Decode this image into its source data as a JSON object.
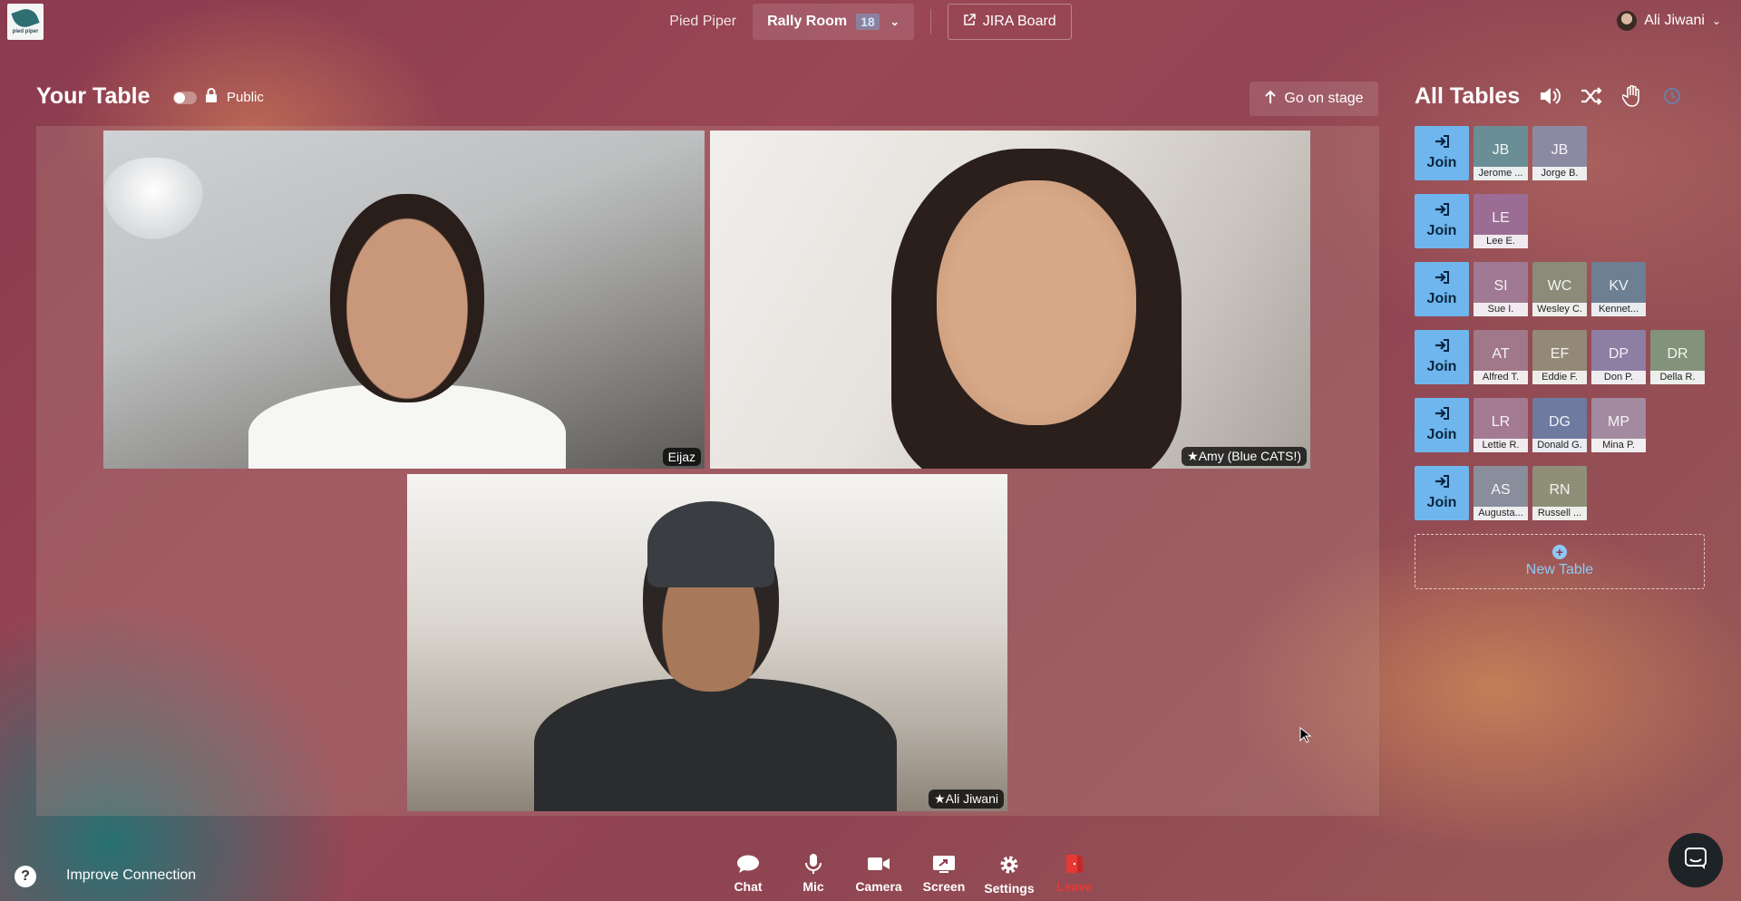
{
  "header": {
    "org_name": "Pied Piper",
    "room_name": "Rally Room",
    "room_count": "18",
    "jira_label": "JIRA Board",
    "user_name": "Ali Jiwani"
  },
  "logo": {
    "text": "pied piper"
  },
  "your_table": {
    "title": "Your Table",
    "visibility": "Public",
    "go_on_stage": "Go on stage",
    "videos": [
      {
        "name": "Eijaz",
        "starred": false
      },
      {
        "name": "Amy (Blue CATS!)",
        "starred": true
      },
      {
        "name": "Ali Jiwani",
        "starred": true
      }
    ]
  },
  "all_tables": {
    "title": "All Tables",
    "join_label": "Join",
    "new_table_label": "New Table",
    "tables": [
      {
        "seats": [
          {
            "initials": "JB",
            "name": "Jerome ...",
            "color": "#6a8e95"
          },
          {
            "initials": "JB",
            "name": "Jorge B.",
            "color": "#8c8aa3"
          }
        ]
      },
      {
        "seats": [
          {
            "initials": "LE",
            "name": "Lee E.",
            "color": "#9b6d94"
          }
        ]
      },
      {
        "seats": [
          {
            "initials": "SI",
            "name": "Sue I.",
            "color": "#a07a94"
          },
          {
            "initials": "WC",
            "name": "Wesley C.",
            "color": "#8b8b79"
          },
          {
            "initials": "KV",
            "name": "Kennet...",
            "color": "#6d7f92"
          }
        ]
      },
      {
        "seats": [
          {
            "initials": "AT",
            "name": "Alfred T.",
            "color": "#a07889"
          },
          {
            "initials": "EF",
            "name": "Eddie F.",
            "color": "#948876"
          },
          {
            "initials": "DP",
            "name": "Don P.",
            "color": "#8d7ea4"
          },
          {
            "initials": "DR",
            "name": "Della R.",
            "color": "#83927a"
          }
        ]
      },
      {
        "seats": [
          {
            "initials": "LR",
            "name": "Lettie R.",
            "color": "#a47a93"
          },
          {
            "initials": "DG",
            "name": "Donald G.",
            "color": "#6e7aa0"
          },
          {
            "initials": "MP",
            "name": "Mina P.",
            "color": "#a28aa0"
          }
        ]
      },
      {
        "seats": [
          {
            "initials": "AS",
            "name": "Augusta...",
            "color": "#8a8d9b"
          },
          {
            "initials": "RN",
            "name": "Russell ...",
            "color": "#8f8f78"
          }
        ]
      }
    ]
  },
  "footer": {
    "help": "?",
    "improve_connection": "Improve Connection",
    "tools": [
      "Chat",
      "Mic",
      "Camera",
      "Screen",
      "Settings",
      "Leave"
    ]
  },
  "colors": {
    "join_blue": "#6fb6ee",
    "leave_red": "#e53935",
    "new_table_blue": "#8fc8f5"
  }
}
